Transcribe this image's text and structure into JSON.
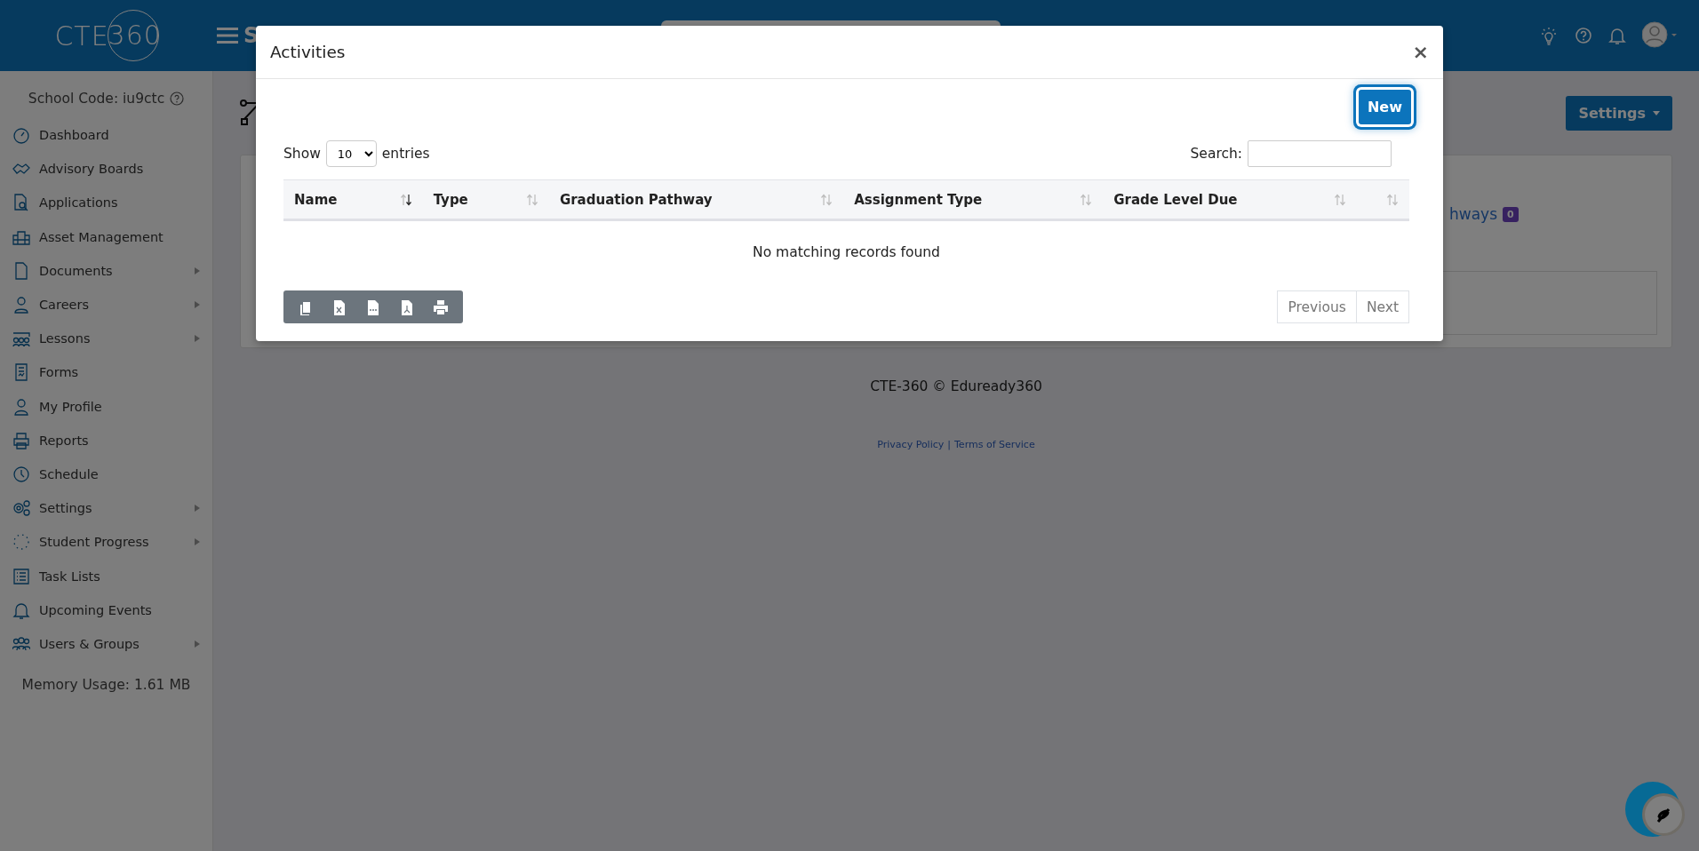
{
  "header": {
    "logo": {
      "letters": "CTE",
      "number": "360"
    },
    "page_title_fragment": "S"
  },
  "sidebar": {
    "school_code": "School Code: iu9ctc",
    "items": [
      {
        "label": "Dashboard",
        "has_submenu": false
      },
      {
        "label": "Advisory Boards",
        "has_submenu": false
      },
      {
        "label": "Applications",
        "has_submenu": false
      },
      {
        "label": "Asset Management",
        "has_submenu": false
      },
      {
        "label": "Documents",
        "has_submenu": true
      },
      {
        "label": "Careers",
        "has_submenu": true
      },
      {
        "label": "Lessons",
        "has_submenu": true
      },
      {
        "label": "Forms",
        "has_submenu": false
      },
      {
        "label": "My Profile",
        "has_submenu": false
      },
      {
        "label": "Reports",
        "has_submenu": false
      },
      {
        "label": "Schedule",
        "has_submenu": false
      },
      {
        "label": "Settings",
        "has_submenu": true
      },
      {
        "label": "Student Progress",
        "has_submenu": true
      },
      {
        "label": "Task Lists",
        "has_submenu": false
      },
      {
        "label": "Upcoming Events",
        "has_submenu": false
      },
      {
        "label": "Users & Groups",
        "has_submenu": true
      }
    ],
    "memory_usage": "Memory Usage: 1.61 MB"
  },
  "page": {
    "settings_button": "Settings",
    "link_fragment": "hways",
    "badge": "0",
    "footer": {
      "copyright": "CTE-360 © Eduready360",
      "links": [
        "Privacy Policy",
        "Terms of Service"
      ],
      "separator": "|"
    }
  },
  "modal": {
    "title": "Activities",
    "close": "×",
    "new_button": "New",
    "length": {
      "before": "Show",
      "value": "10",
      "after": "entries"
    },
    "search_label": "Search:",
    "columns": [
      {
        "label": "Name",
        "sorted": true
      },
      {
        "label": "Type",
        "sorted": false
      },
      {
        "label": "Graduation Pathway",
        "sorted": false
      },
      {
        "label": "Assignment Type",
        "sorted": false
      },
      {
        "label": "Grade Level Due",
        "sorted": false
      },
      {
        "sorted": false
      }
    ],
    "empty_message": "No matching records found",
    "export_buttons": [
      {
        "kind": "copy"
      },
      {
        "kind": "excel"
      },
      {
        "kind": "csv"
      },
      {
        "kind": "pdf"
      },
      {
        "kind": "print"
      }
    ],
    "pagination": [
      {
        "label": "Previous",
        "disabled": true
      },
      {
        "label": "Next",
        "disabled": true
      }
    ]
  }
}
